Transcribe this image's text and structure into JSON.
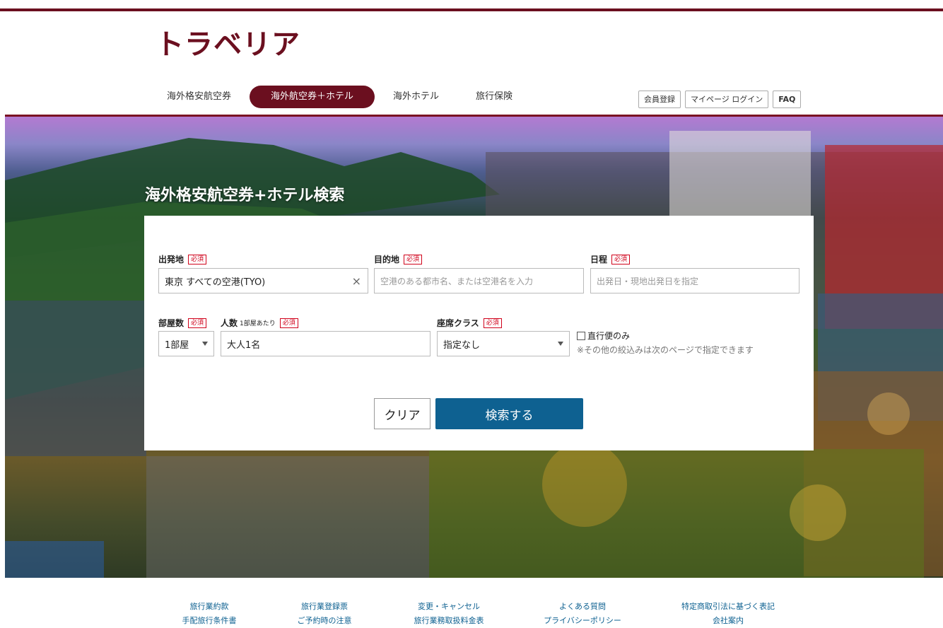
{
  "brand": {
    "logo": "トラベリア",
    "color": "#6b0f1f"
  },
  "nav": {
    "tabs": [
      {
        "label": "海外格安航空券",
        "active": false
      },
      {
        "label": "海外航空券＋ホテル",
        "active": true
      },
      {
        "label": "海外ホテル",
        "active": false
      },
      {
        "label": "旅行保険",
        "active": false
      }
    ]
  },
  "account": {
    "register": "会員登録",
    "login": "マイページ ログイン",
    "faq": "FAQ"
  },
  "hero": {
    "title": "海外格安航空券+ホテル検索"
  },
  "search": {
    "required": "必須",
    "origin": {
      "label": "出発地",
      "value": "東京 すべての空港(TYO)",
      "clear_icon": "×"
    },
    "destination": {
      "label": "目的地",
      "placeholder": "空港のある都市名、または空港名を入力"
    },
    "dates": {
      "label": "日程",
      "placeholder": "出発日・現地出発日を指定"
    },
    "rooms": {
      "label": "部屋数",
      "value": "1部屋"
    },
    "people": {
      "label": "人数",
      "sublabel": "1部屋あたり",
      "value": "大人1名"
    },
    "seat_class": {
      "label": "座席クラス",
      "value": "指定なし"
    },
    "nonstop": {
      "label": "直行便のみ",
      "checked": false
    },
    "note": "※その他の絞込みは次のページで指定できます",
    "clear_button": "クリア",
    "search_button": "検索する"
  },
  "footer": {
    "col1": [
      "旅行業約款",
      "手配旅行条件書"
    ],
    "col2": [
      "旅行業登録票",
      "ご予約時の注意"
    ],
    "col3": [
      "変更・キャンセル",
      "旅行業務取扱料金表"
    ],
    "col4": [
      "よくある質問",
      "プライバシーポリシー"
    ],
    "col5": [
      "特定商取引法に基づく表記",
      "会社案内"
    ]
  }
}
